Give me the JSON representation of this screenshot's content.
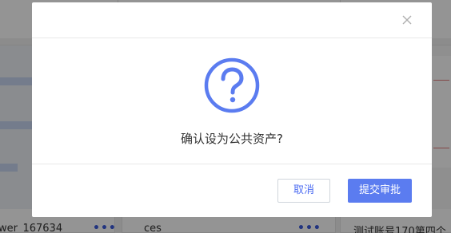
{
  "dialog": {
    "message": "确认设为公共资产?",
    "cancel_label": "取消",
    "submit_label": "提交审批",
    "close_icon": "close-icon",
    "status_icon": "question-circle-icon",
    "accent_color": "#5b7cf0"
  },
  "background": {
    "cards": [
      {
        "label": "wer_167634"
      },
      {
        "label": "ces"
      },
      {
        "label": "测试账号170第四个"
      }
    ],
    "more_icon": "more-dots-icon"
  }
}
